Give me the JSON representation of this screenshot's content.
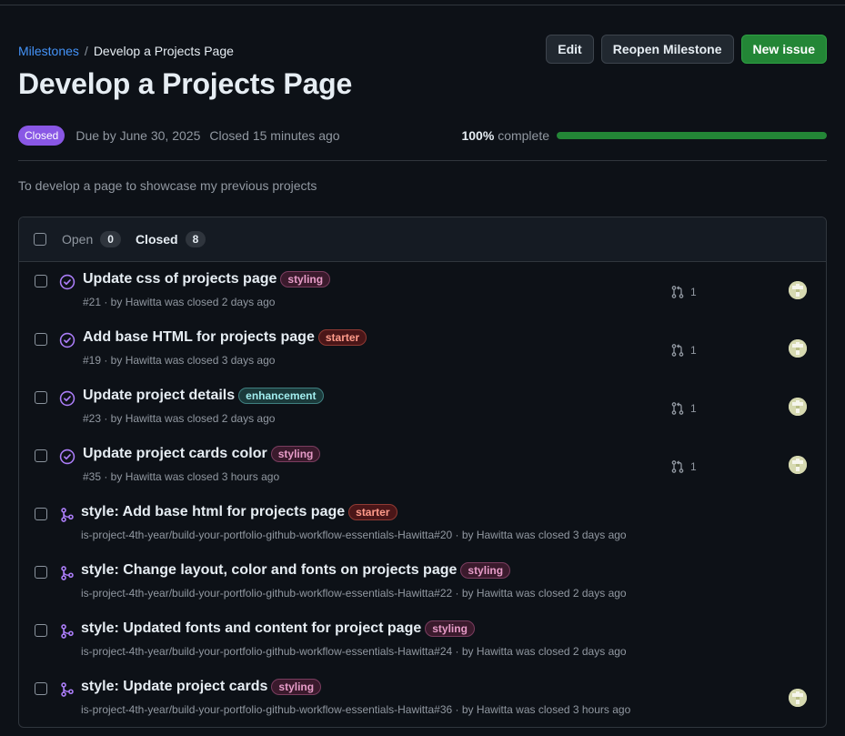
{
  "colors": {
    "accent": "#4493f8",
    "closed_purple": "#8957e5",
    "success_green": "#238636"
  },
  "breadcrumb": {
    "link": "Milestones",
    "separator": "/",
    "current": "Develop a Projects Page"
  },
  "title": "Develop a Projects Page",
  "actions": {
    "edit": "Edit",
    "reopen": "Reopen Milestone",
    "new_issue": "New issue"
  },
  "meta": {
    "state": "Closed",
    "due": "Due by June 30, 2025",
    "closed_ago": "Closed 15 minutes ago"
  },
  "progress": {
    "percent_label": "100%",
    "complete_label": "complete",
    "fraction": 1.0
  },
  "description": "To develop a page to showcase my previous projects",
  "list_header": {
    "open_label": "Open",
    "open_count": "0",
    "closed_label": "Closed",
    "closed_count": "8"
  },
  "items": [
    {
      "kind": "issue",
      "title": "Update css of projects page",
      "label": "styling",
      "subtitle": "#21 · by Hawitta was closed 2 days ago",
      "linked_pr_count": "1",
      "icon": "issue-closed-icon",
      "has_avatar": true
    },
    {
      "kind": "issue",
      "title": "Add base HTML for projects page",
      "label": "starter",
      "subtitle": "#19 · by Hawitta was closed 3 days ago",
      "linked_pr_count": "1",
      "icon": "issue-closed-icon",
      "has_avatar": true
    },
    {
      "kind": "issue",
      "title": "Update project details",
      "label": "enhancement",
      "subtitle": "#23 · by Hawitta was closed 2 days ago",
      "linked_pr_count": "1",
      "icon": "issue-closed-icon",
      "has_avatar": true
    },
    {
      "kind": "issue",
      "title": "Update project cards color",
      "label": "styling",
      "subtitle": "#35 · by Hawitta was closed 3 hours ago",
      "linked_pr_count": "1",
      "icon": "issue-closed-icon",
      "has_avatar": true
    },
    {
      "kind": "pr",
      "title": "style: Add base html for projects page",
      "label": "starter",
      "subtitle": "is-project-4th-year/build-your-portfolio-github-workflow-essentials-Hawitta#20 · by Hawitta was closed 3 days ago",
      "linked_pr_count": "",
      "icon": "pull-request-merged-icon",
      "has_avatar": false
    },
    {
      "kind": "pr",
      "title": "style: Change layout, color and fonts on projects page",
      "label": "styling",
      "subtitle": "is-project-4th-year/build-your-portfolio-github-workflow-essentials-Hawitta#22 · by Hawitta was closed 2 days ago",
      "linked_pr_count": "",
      "icon": "pull-request-merged-icon",
      "has_avatar": false
    },
    {
      "kind": "pr",
      "title": "style: Updated fonts and content for project page",
      "label": "styling",
      "subtitle": "is-project-4th-year/build-your-portfolio-github-workflow-essentials-Hawitta#24 · by Hawitta was closed 2 days ago",
      "linked_pr_count": "",
      "icon": "pull-request-merged-icon",
      "has_avatar": false
    },
    {
      "kind": "pr",
      "title": "style: Update project cards",
      "label": "styling",
      "subtitle": "is-project-4th-year/build-your-portfolio-github-workflow-essentials-Hawitta#36 · by Hawitta was closed 3 hours ago",
      "linked_pr_count": "",
      "icon": "pull-request-merged-icon",
      "has_avatar": true
    }
  ],
  "label_styles": {
    "styling": {
      "text": "#e79cc8",
      "bg": "#3a1a2c",
      "border": "#7a3d5f"
    },
    "starter": {
      "text": "#ff9b8a",
      "bg": "#4a1618",
      "border": "#8f3a33"
    },
    "enhancement": {
      "text": "#a2eeef",
      "bg": "#1b3a3b",
      "border": "#3f7f80"
    }
  }
}
